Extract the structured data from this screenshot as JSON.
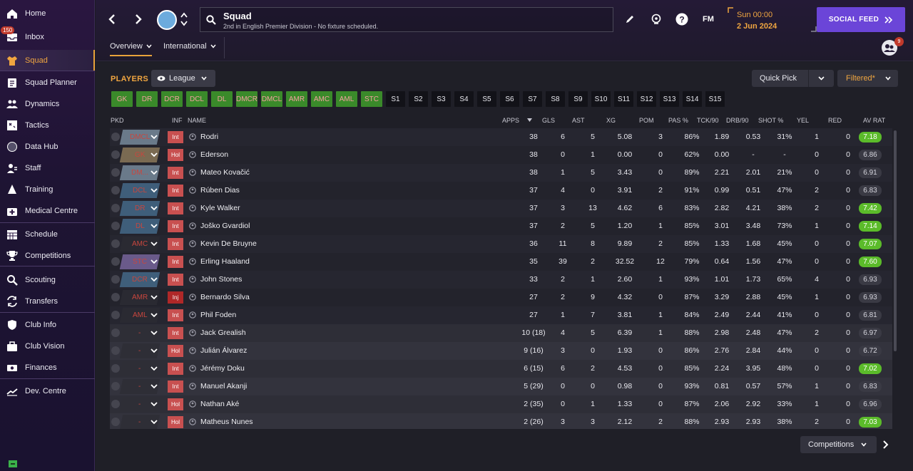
{
  "sidebar": {
    "inbox_badge": "150",
    "items": [
      {
        "label": "Home",
        "icon": "home-icon"
      },
      {
        "label": "Inbox",
        "icon": "inbox-icon"
      },
      {
        "label": "Squad",
        "icon": "shirt-icon"
      },
      {
        "label": "Squad Planner",
        "icon": "clipboard-icon"
      },
      {
        "label": "Dynamics",
        "icon": "people-icon"
      },
      {
        "label": "Tactics",
        "icon": "tactics-board-icon"
      },
      {
        "label": "Data Hub",
        "icon": "globe-icon"
      },
      {
        "label": "Staff",
        "icon": "staff-icon"
      },
      {
        "label": "Training",
        "icon": "training-cone-icon"
      },
      {
        "label": "Medical Centre",
        "icon": "medical-kit-icon"
      },
      {
        "label": "Schedule",
        "icon": "calendar-icon"
      },
      {
        "label": "Competitions",
        "icon": "trophy-icon"
      },
      {
        "label": "Scouting",
        "icon": "search-icon"
      },
      {
        "label": "Transfers",
        "icon": "transfer-icon"
      },
      {
        "label": "Club Info",
        "icon": "shield-icon"
      },
      {
        "label": "Club Vision",
        "icon": "briefcase-icon"
      },
      {
        "label": "Finances",
        "icon": "money-icon"
      },
      {
        "label": "Dev. Centre",
        "icon": "growth-icon"
      }
    ]
  },
  "header": {
    "title": "Squad",
    "subtitle": "2nd in English Premier Division - No fixture scheduled.",
    "date_time": "Sun 00:00",
    "date": "2 Jun 2024",
    "fm_label": "FM",
    "social_feed": "SOCIAL FEED",
    "avatar_badge": "9",
    "tabs": [
      "Overview",
      "International"
    ]
  },
  "controls": {
    "players_label": "PLAYERS",
    "league_label": "League",
    "quick_pick": "Quick Pick",
    "filtered": "Filtered*",
    "competitions": "Competitions"
  },
  "positions": [
    "GK",
    "DR",
    "DCR",
    "DCL",
    "DL",
    "DMCR",
    "DMCL",
    "AMR",
    "AMC",
    "AML",
    "STC",
    "S1",
    "S2",
    "S3",
    "S4",
    "S5",
    "S6",
    "S7",
    "S8",
    "S9",
    "S10",
    "S11",
    "S12",
    "S13",
    "S14",
    "S15"
  ],
  "columns": {
    "pkd": "PKD",
    "inf": "INF",
    "name": "NAME",
    "apps": "APPS",
    "gls": "GLS",
    "ast": "AST",
    "xg": "XG",
    "pom": "POM",
    "pas": "PAS %",
    "tck": "TCK/90",
    "drb": "DRB/90",
    "shot": "SHOT %",
    "yel": "YEL",
    "red": "RED",
    "rat": "AV RAT"
  },
  "players": [
    {
      "pos": "DMCL",
      "inf": "Int",
      "name": "Rodri",
      "apps": "38",
      "gls": "6",
      "ast": "5",
      "xg": "5.08",
      "pom": "3",
      "pas": "86%",
      "tck": "1.89",
      "drb": "0.53",
      "shot": "31%",
      "yel": "1",
      "red": "0",
      "rat": "7.18",
      "rating": "good"
    },
    {
      "pos": "GK",
      "inf": "Hol",
      "name": "Ederson",
      "apps": "38",
      "gls": "0",
      "ast": "1",
      "xg": "0.00",
      "pom": "0",
      "pas": "62%",
      "tck": "0.00",
      "drb": "-",
      "shot": "-",
      "yel": "0",
      "red": "0",
      "rat": "6.86",
      "rating": "ok"
    },
    {
      "pos": "DM...",
      "inf": "Int",
      "name": "Mateo Kovačić",
      "apps": "38",
      "gls": "1",
      "ast": "5",
      "xg": "3.43",
      "pom": "0",
      "pas": "89%",
      "tck": "2.21",
      "drb": "2.01",
      "shot": "21%",
      "yel": "0",
      "red": "0",
      "rat": "6.91",
      "rating": "ok"
    },
    {
      "pos": "DCL",
      "inf": "Int",
      "name": "Rúben Dias",
      "apps": "37",
      "gls": "4",
      "ast": "0",
      "xg": "3.91",
      "pom": "2",
      "pas": "91%",
      "tck": "0.99",
      "drb": "0.51",
      "shot": "47%",
      "yel": "2",
      "red": "0",
      "rat": "6.83",
      "rating": "ok"
    },
    {
      "pos": "DR",
      "inf": "Int",
      "name": "Kyle Walker",
      "apps": "37",
      "gls": "3",
      "ast": "13",
      "xg": "4.62",
      "pom": "6",
      "pas": "83%",
      "tck": "2.82",
      "drb": "4.21",
      "shot": "38%",
      "yel": "2",
      "red": "0",
      "rat": "7.42",
      "rating": "good"
    },
    {
      "pos": "DL",
      "inf": "Int",
      "name": "Joško Gvardiol",
      "apps": "37",
      "gls": "2",
      "ast": "5",
      "xg": "1.20",
      "pom": "1",
      "pas": "85%",
      "tck": "3.01",
      "drb": "3.48",
      "shot": "73%",
      "yel": "1",
      "red": "0",
      "rat": "7.14",
      "rating": "good"
    },
    {
      "pos": "AMC",
      "inf": "Int",
      "name": "Kevin De Bruyne",
      "apps": "36",
      "gls": "11",
      "ast": "8",
      "xg": "9.89",
      "pom": "2",
      "pas": "85%",
      "tck": "1.33",
      "drb": "1.68",
      "shot": "45%",
      "yel": "0",
      "red": "0",
      "rat": "7.07",
      "rating": "good"
    },
    {
      "pos": "STC",
      "inf": "Int",
      "name": "Erling Haaland",
      "apps": "35",
      "gls": "39",
      "ast": "2",
      "xg": "32.52",
      "pom": "12",
      "pas": "79%",
      "tck": "0.64",
      "drb": "1.56",
      "shot": "47%",
      "yel": "0",
      "red": "0",
      "rat": "7.60",
      "rating": "good"
    },
    {
      "pos": "DCR",
      "inf": "Int",
      "name": "John Stones",
      "apps": "33",
      "gls": "2",
      "ast": "1",
      "xg": "2.60",
      "pom": "1",
      "pas": "93%",
      "tck": "1.01",
      "drb": "1.73",
      "shot": "65%",
      "yel": "4",
      "red": "0",
      "rat": "6.93",
      "rating": "ok"
    },
    {
      "pos": "AMR",
      "inf": "Inj",
      "name": "Bernardo Silva",
      "apps": "27",
      "gls": "2",
      "ast": "9",
      "xg": "4.32",
      "pom": "0",
      "pas": "87%",
      "tck": "3.29",
      "drb": "2.88",
      "shot": "45%",
      "yel": "1",
      "red": "0",
      "rat": "6.93",
      "rating": "ok"
    },
    {
      "pos": "AML",
      "inf": "Int",
      "name": "Phil Foden",
      "apps": "27",
      "gls": "1",
      "ast": "7",
      "xg": "3.81",
      "pom": "1",
      "pas": "84%",
      "tck": "2.49",
      "drb": "2.44",
      "shot": "41%",
      "yel": "0",
      "red": "0",
      "rat": "6.81",
      "rating": "ok"
    },
    {
      "pos": "-",
      "inf": "Int",
      "name": "Jack Grealish",
      "apps": "10 (18)",
      "gls": "4",
      "ast": "5",
      "xg": "6.39",
      "pom": "1",
      "pas": "88%",
      "tck": "2.98",
      "drb": "2.48",
      "shot": "47%",
      "yel": "2",
      "red": "0",
      "rat": "6.97",
      "rating": "ok"
    },
    {
      "pos": "-",
      "inf": "Hol",
      "name": "Julián Álvarez",
      "apps": "9 (16)",
      "gls": "3",
      "ast": "0",
      "xg": "1.93",
      "pom": "0",
      "pas": "86%",
      "tck": "2.76",
      "drb": "2.84",
      "shot": "44%",
      "yel": "0",
      "red": "0",
      "rat": "6.72",
      "rating": "ok"
    },
    {
      "pos": "-",
      "inf": "Int",
      "name": "Jérémy Doku",
      "apps": "6 (15)",
      "gls": "6",
      "ast": "2",
      "xg": "4.53",
      "pom": "0",
      "pas": "85%",
      "tck": "2.24",
      "drb": "3.95",
      "shot": "48%",
      "yel": "0",
      "red": "0",
      "rat": "7.02",
      "rating": "good"
    },
    {
      "pos": "-",
      "inf": "Int",
      "name": "Manuel Akanji",
      "apps": "5 (29)",
      "gls": "0",
      "ast": "0",
      "xg": "0.98",
      "pom": "0",
      "pas": "93%",
      "tck": "0.81",
      "drb": "0.57",
      "shot": "57%",
      "yel": "1",
      "red": "0",
      "rat": "6.83",
      "rating": "ok"
    },
    {
      "pos": "-",
      "inf": "Hol",
      "name": "Nathan Aké",
      "apps": "2 (35)",
      "gls": "0",
      "ast": "1",
      "xg": "1.33",
      "pom": "0",
      "pas": "87%",
      "tck": "2.06",
      "drb": "2.92",
      "shot": "33%",
      "yel": "1",
      "red": "0",
      "rat": "6.96",
      "rating": "ok"
    },
    {
      "pos": "-",
      "inf": "Hol",
      "name": "Matheus Nunes",
      "apps": "2 (26)",
      "gls": "3",
      "ast": "3",
      "xg": "2.12",
      "pom": "2",
      "pas": "88%",
      "tck": "2.93",
      "drb": "2.93",
      "shot": "38%",
      "yel": "2",
      "red": "0",
      "rat": "7.03",
      "rating": "good"
    }
  ],
  "colors": {
    "accent_orange": "#f0a640",
    "social_purple": "#6b45d8",
    "rating_green": "#5bbb2a",
    "position_green": "#3a8a2a",
    "inf_red": "#c85050"
  }
}
